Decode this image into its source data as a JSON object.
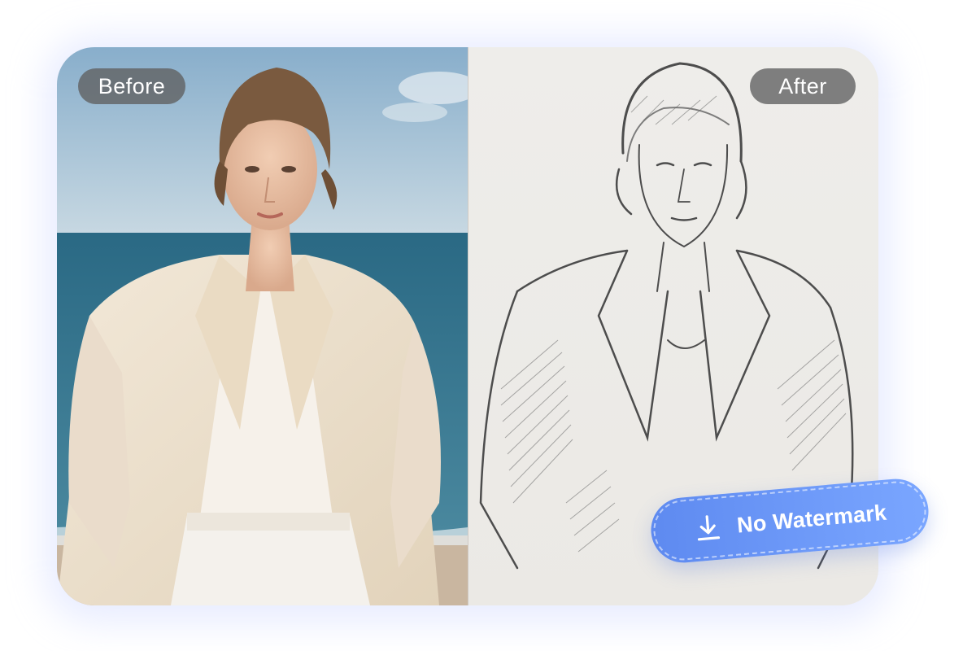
{
  "comparison": {
    "before_label": "Before",
    "after_label": "After"
  },
  "badge": {
    "label": "No Watermark",
    "icon": "download-icon"
  },
  "colors": {
    "pill_bg": "#5f5f5f",
    "badge_start": "#5e8af0",
    "badge_end": "#7aa6ff",
    "sky": "#9ec0d8",
    "sea": "#2f6f8a",
    "sketch_paper": "#eeedea"
  }
}
